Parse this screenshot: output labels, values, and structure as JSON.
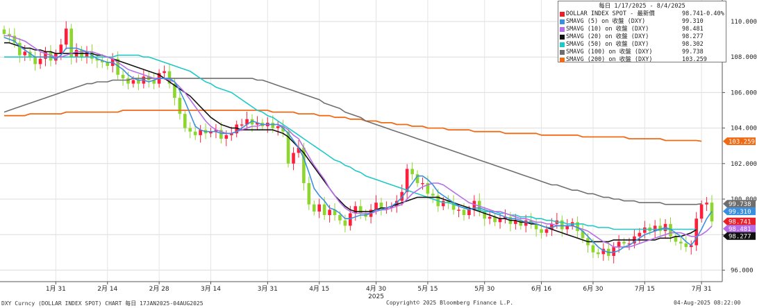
{
  "legend": {
    "header": "每日 1/17/2025 - 8/4/2025",
    "rows": [
      {
        "name": "DOLLAR INDEX SPOT - 最新價",
        "value": "98.741",
        "change": "-0.40%",
        "color": "#e8202a"
      },
      {
        "name": "SMAVG (5)  on 收盤 (DXY)",
        "value": "99.310",
        "change": "",
        "color": "#3b8fe0"
      },
      {
        "name": "SMAVG (10)  on 收盤 (DXY)",
        "value": "98.481",
        "change": "",
        "color": "#b66de8"
      },
      {
        "name": "SMAVG (20)  on 收盤 (DXY)",
        "value": "98.277",
        "change": "",
        "color": "#111111"
      },
      {
        "name": "SMAVG (50)  on 收盤 (DXY)",
        "value": "98.302",
        "change": "",
        "color": "#1ec8c8"
      },
      {
        "name": "SMAVG (100)  on 收盤 (DXY)",
        "value": "99.738",
        "change": "",
        "color": "#6e6e6e"
      },
      {
        "name": "SMAVG (200)  on 收盤 (DXY)",
        "value": "103.259",
        "change": "",
        "color": "#f06a14"
      }
    ]
  },
  "footer": {
    "left": "DXY Curncy (DOLLAR INDEX SPOT) CHART  每日 17JAN2025-04AUG2025",
    "center": "Copyright© 2025 Bloomberg Finance L.P.",
    "right": "04-Aug-2025 08:22:00"
  },
  "chart_data": {
    "type": "candlestick",
    "y_ticks": [
      "110.000",
      "108.000",
      "106.000",
      "104.000",
      "102.000",
      "100.000",
      "98.000",
      "96.000"
    ],
    "ylim": [
      95.2,
      110.5
    ],
    "x_tick_labels": [
      "1月 31",
      "2月 14",
      "2月 28",
      "3月 14",
      "3月 31",
      "4月 15",
      "4月 30",
      "5月 15",
      "5月 30",
      "6月 16",
      "6月 30",
      "7月 15",
      "7月 31"
    ],
    "x_tick_index": [
      10,
      20,
      30,
      40,
      51,
      61,
      72,
      82,
      93,
      104,
      114,
      124,
      135
    ],
    "year_label": "2025",
    "year_index": 72,
    "up_color": "#ff1f3c",
    "down_color": "#8ed62e",
    "close": [
      109.3,
      109.2,
      108.8,
      108.1,
      108.3,
      108.0,
      107.6,
      107.9,
      108.3,
      107.8,
      108.2,
      108.7,
      109.6,
      108.0,
      108.4,
      108.0,
      108.3,
      107.9,
      107.8,
      107.7,
      107.5,
      107.9,
      107.0,
      106.8,
      106.5,
      106.7,
      106.5,
      106.9,
      106.7,
      106.5,
      107.1,
      107.2,
      106.5,
      105.7,
      104.8,
      104.0,
      103.8,
      103.6,
      103.9,
      103.7,
      103.8,
      103.9,
      103.4,
      103.6,
      103.7,
      104.2,
      104.2,
      104.5,
      104.2,
      104.3,
      104.1,
      104.3,
      104.0,
      104.1,
      103.8,
      102.0,
      102.6,
      102.9,
      100.9,
      99.7,
      99.3,
      99.7,
      99.1,
      99.4,
      99.1,
      98.8,
      98.5,
      99.2,
      99.6,
      99.2,
      99.0,
      99.4,
      99.8,
      99.5,
      99.5,
      99.6,
      99.9,
      100.4,
      101.7,
      101.4,
      100.9,
      100.9,
      100.3,
      100.2,
      99.6,
      99.9,
      99.8,
      99.4,
      99.4,
      99.1,
      99.4,
      99.9,
      99.3,
      98.9,
      99.0,
      98.7,
      98.9,
      99.0,
      98.6,
      98.8,
      98.5,
      98.8,
      98.6,
      98.3,
      98.1,
      98.3,
      98.6,
      98.8,
      98.3,
      98.5,
      98.7,
      98.2,
      97.8,
      97.4,
      97.0,
      96.9,
      97.2,
      96.8,
      97.3,
      97.6,
      97.5,
      97.5,
      97.9,
      98.1,
      98.4,
      98.2,
      98.5,
      98.2,
      98.6,
      97.9,
      97.6,
      97.5,
      97.3,
      97.4,
      98.9,
      99.7,
      99.8,
      98.741
    ],
    "sma_5": [
      109.1,
      109.0,
      108.9,
      108.6,
      108.4,
      108.2,
      108.0,
      108.0,
      108.0,
      108.0,
      107.9,
      108.1,
      108.5,
      108.5,
      108.5,
      108.4,
      108.3,
      108.1,
      107.9,
      107.8,
      107.7,
      107.7,
      107.5,
      107.3,
      107.0,
      106.8,
      106.7,
      106.7,
      106.6,
      106.7,
      106.8,
      106.8,
      106.8,
      106.6,
      106.1,
      105.5,
      104.8,
      104.1,
      103.9,
      103.8,
      103.8,
      103.8,
      103.7,
      103.7,
      103.7,
      103.8,
      104.0,
      104.2,
      104.4,
      104.3,
      104.2,
      104.2,
      104.2,
      104.2,
      104.0,
      103.7,
      103.3,
      102.9,
      102.3,
      101.5,
      100.6,
      100.2,
      99.9,
      99.5,
      99.4,
      99.2,
      98.9,
      98.9,
      99.0,
      99.1,
      99.1,
      99.2,
      99.4,
      99.4,
      99.5,
      99.6,
      99.8,
      100.1,
      100.5,
      100.9,
      101.3,
      101.3,
      101.1,
      100.8,
      100.4,
      100.2,
      100.0,
      99.8,
      99.6,
      99.5,
      99.4,
      99.5,
      99.5,
      99.4,
      99.3,
      99.2,
      99.1,
      99.0,
      98.9,
      98.9,
      98.8,
      98.7,
      98.7,
      98.6,
      98.5,
      98.4,
      98.4,
      98.5,
      98.5,
      98.5,
      98.5,
      98.4,
      98.2,
      97.9,
      97.6,
      97.3,
      97.1,
      97.0,
      97.0,
      97.1,
      97.3,
      97.4,
      97.6,
      97.8,
      98.0,
      98.1,
      98.2,
      98.3,
      98.4,
      98.3,
      98.1,
      97.9,
      97.6,
      97.4,
      97.8,
      98.3,
      98.9,
      99.31
    ],
    "sma_10": [
      109.2,
      109.2,
      109.1,
      109.0,
      108.9,
      108.7,
      108.5,
      108.3,
      108.2,
      108.1,
      108.0,
      108.0,
      108.1,
      108.2,
      108.3,
      108.3,
      108.3,
      108.3,
      108.2,
      108.1,
      108.0,
      107.9,
      107.7,
      107.5,
      107.3,
      107.2,
      107.1,
      107.0,
      106.9,
      106.8,
      106.8,
      106.8,
      106.7,
      106.6,
      106.3,
      106.0,
      105.6,
      105.2,
      104.8,
      104.4,
      104.1,
      103.9,
      103.8,
      103.7,
      103.7,
      103.8,
      103.9,
      104.0,
      104.1,
      104.1,
      104.2,
      104.2,
      104.2,
      104.2,
      104.1,
      103.9,
      103.6,
      103.4,
      102.9,
      102.4,
      101.9,
      101.5,
      101.1,
      100.6,
      100.2,
      99.8,
      99.5,
      99.3,
      99.2,
      99.2,
      99.2,
      99.2,
      99.3,
      99.4,
      99.4,
      99.5,
      99.6,
      99.7,
      100.0,
      100.3,
      100.5,
      100.7,
      100.8,
      100.9,
      100.9,
      100.8,
      100.6,
      100.4,
      100.2,
      100.0,
      99.8,
      99.7,
      99.6,
      99.5,
      99.4,
      99.3,
      99.3,
      99.2,
      99.1,
      99.0,
      98.9,
      98.9,
      98.8,
      98.7,
      98.7,
      98.6,
      98.6,
      98.5,
      98.5,
      98.5,
      98.5,
      98.4,
      98.3,
      98.2,
      98.0,
      97.8,
      97.6,
      97.5,
      97.3,
      97.3,
      97.3,
      97.3,
      97.4,
      97.5,
      97.6,
      97.7,
      97.8,
      97.9,
      98.0,
      98.1,
      98.1,
      98.1,
      98.0,
      97.9,
      97.9,
      98.0,
      98.2,
      98.481
    ],
    "sma_20": [
      108.8,
      108.8,
      108.7,
      108.6,
      108.5,
      108.5,
      108.4,
      108.4,
      108.3,
      108.3,
      108.2,
      108.2,
      108.2,
      108.2,
      108.2,
      108.2,
      108.2,
      108.2,
      108.1,
      108.1,
      108.0,
      107.9,
      107.8,
      107.7,
      107.6,
      107.5,
      107.4,
      107.3,
      107.2,
      107.1,
      107.0,
      106.8,
      106.6,
      106.4,
      106.2,
      106.0,
      105.8,
      105.5,
      105.2,
      104.9,
      104.6,
      104.4,
      104.2,
      104.1,
      104.0,
      104.0,
      103.9,
      103.9,
      103.9,
      103.9,
      103.9,
      103.9,
      103.9,
      103.8,
      103.7,
      103.5,
      103.2,
      102.9,
      102.6,
      102.2,
      101.8,
      101.4,
      101.0,
      100.6,
      100.2,
      99.9,
      99.6,
      99.4,
      99.3,
      99.3,
      99.3,
      99.3,
      99.4,
      99.5,
      99.5,
      99.6,
      99.7,
      99.8,
      99.9,
      100.0,
      100.1,
      100.1,
      100.1,
      100.1,
      100.1,
      100.0,
      99.9,
      99.8,
      99.7,
      99.6,
      99.5,
      99.4,
      99.3,
      99.2,
      99.1,
      99.0,
      98.9,
      98.9,
      98.8,
      98.8,
      98.7,
      98.7,
      98.6,
      98.6,
      98.5,
      98.4,
      98.3,
      98.2,
      98.1,
      98.0,
      97.9,
      97.8,
      97.7,
      97.6,
      97.6,
      97.6,
      97.6,
      97.6,
      97.7,
      97.7,
      97.7,
      97.7,
      97.7,
      97.7,
      97.7,
      97.7,
      97.7,
      97.8,
      97.8,
      97.8,
      97.9,
      97.9,
      98.0,
      98.1,
      98.277
    ],
    "sma_50": [
      108.0,
      108.0,
      108.0,
      108.0,
      108.0,
      108.0,
      108.0,
      108.0,
      108.0,
      108.0,
      108.0,
      108.0,
      108.0,
      108.0,
      108.0,
      108.0,
      108.0,
      108.0,
      108.0,
      108.0,
      108.0,
      108.0,
      108.1,
      108.1,
      108.1,
      108.1,
      108.1,
      108.0,
      108.0,
      107.9,
      107.8,
      107.7,
      107.6,
      107.5,
      107.4,
      107.3,
      107.2,
      107.0,
      106.8,
      106.6,
      106.5,
      106.3,
      106.2,
      106.1,
      106.0,
      105.8,
      105.6,
      105.4,
      105.2,
      105.0,
      104.9,
      104.7,
      104.6,
      104.4,
      104.2,
      104.0,
      103.8,
      103.6,
      103.4,
      103.2,
      103.0,
      102.8,
      102.6,
      102.4,
      102.2,
      102.1,
      101.9,
      101.8,
      101.6,
      101.5,
      101.3,
      101.2,
      101.1,
      101.0,
      100.9,
      100.8,
      100.7,
      100.6,
      100.5,
      100.4,
      100.3,
      100.2,
      100.1,
      100.0,
      99.9,
      99.8,
      99.8,
      99.7,
      99.6,
      99.5,
      99.5,
      99.4,
      99.4,
      99.3,
      99.3,
      99.3,
      99.2,
      99.2,
      99.1,
      99.1,
      99.0,
      99.0,
      99.0,
      98.9,
      98.9,
      98.8,
      98.8,
      98.7,
      98.7,
      98.6,
      98.6,
      98.6,
      98.6,
      98.5,
      98.5,
      98.4,
      98.4,
      98.4,
      98.3,
      98.3,
      98.3,
      98.3,
      98.3,
      98.3,
      98.3,
      98.3,
      98.3,
      98.3,
      98.3,
      98.3,
      98.3,
      98.3,
      98.3,
      98.3,
      98.302
    ],
    "sma_100": [
      104.9,
      105.0,
      105.1,
      105.2,
      105.3,
      105.4,
      105.5,
      105.6,
      105.7,
      105.8,
      105.9,
      106.0,
      106.1,
      106.2,
      106.3,
      106.4,
      106.5,
      106.5,
      106.6,
      106.6,
      106.6,
      106.7,
      106.7,
      106.7,
      106.7,
      106.8,
      106.8,
      106.8,
      106.8,
      106.8,
      106.8,
      106.8,
      106.8,
      106.8,
      106.8,
      106.8,
      106.8,
      106.8,
      106.8,
      106.8,
      106.8,
      106.8,
      106.8,
      106.8,
      106.8,
      106.8,
      106.8,
      106.8,
      106.8,
      106.7,
      106.7,
      106.6,
      106.5,
      106.4,
      106.3,
      106.2,
      106.1,
      106.0,
      105.9,
      105.8,
      105.7,
      105.6,
      105.4,
      105.3,
      105.2,
      105.1,
      104.9,
      104.8,
      104.7,
      104.6,
      104.4,
      104.3,
      104.2,
      104.1,
      104.0,
      103.9,
      103.8,
      103.7,
      103.6,
      103.5,
      103.4,
      103.3,
      103.2,
      103.1,
      103.0,
      102.9,
      102.8,
      102.7,
      102.6,
      102.5,
      102.4,
      102.3,
      102.2,
      102.1,
      102.0,
      101.9,
      101.8,
      101.7,
      101.6,
      101.5,
      101.4,
      101.3,
      101.2,
      101.1,
      101.0,
      100.9,
      100.8,
      100.8,
      100.7,
      100.6,
      100.5,
      100.5,
      100.4,
      100.3,
      100.3,
      100.2,
      100.1,
      100.1,
      100.0,
      100.0,
      99.9,
      99.9,
      99.9,
      99.8,
      99.8,
      99.8,
      99.8,
      99.8,
      99.7,
      99.7,
      99.7,
      99.7,
      99.7,
      99.7,
      99.7,
      99.738
    ],
    "sma_200": [
      104.7,
      104.7,
      104.7,
      104.7,
      104.7,
      104.8,
      104.8,
      104.8,
      104.8,
      104.8,
      104.8,
      104.8,
      104.9,
      104.9,
      104.9,
      104.9,
      104.9,
      104.9,
      104.9,
      104.9,
      104.9,
      104.9,
      104.9,
      105.0,
      105.0,
      105.0,
      105.0,
      105.0,
      105.0,
      105.0,
      105.0,
      105.0,
      105.0,
      105.0,
      105.0,
      105.0,
      105.0,
      105.0,
      105.0,
      105.0,
      105.0,
      105.0,
      105.0,
      105.0,
      105.0,
      105.0,
      105.0,
      105.0,
      105.0,
      105.0,
      105.0,
      105.0,
      104.9,
      104.9,
      104.9,
      104.9,
      104.9,
      104.8,
      104.8,
      104.8,
      104.8,
      104.7,
      104.7,
      104.7,
      104.6,
      104.6,
      104.6,
      104.5,
      104.5,
      104.5,
      104.4,
      104.4,
      104.4,
      104.3,
      104.3,
      104.3,
      104.2,
      104.2,
      104.2,
      104.1,
      104.1,
      104.1,
      104.0,
      104.0,
      104.0,
      104.0,
      103.9,
      103.9,
      103.9,
      103.9,
      103.9,
      103.8,
      103.8,
      103.8,
      103.8,
      103.8,
      103.8,
      103.7,
      103.7,
      103.7,
      103.7,
      103.7,
      103.7,
      103.7,
      103.6,
      103.6,
      103.6,
      103.6,
      103.6,
      103.6,
      103.6,
      103.6,
      103.5,
      103.5,
      103.5,
      103.5,
      103.5,
      103.5,
      103.5,
      103.5,
      103.5,
      103.4,
      103.4,
      103.4,
      103.4,
      103.4,
      103.4,
      103.4,
      103.3,
      103.3,
      103.3,
      103.3,
      103.3,
      103.3,
      103.3,
      103.259
    ],
    "right_axis_labels": [
      {
        "text": "103.259",
        "value": 103.259,
        "color": "#f06a14"
      },
      {
        "text": "99.738",
        "value": 99.738,
        "color": "#6e6e6e"
      },
      {
        "text": "99.310",
        "value": 99.31,
        "color": "#3b8fe0"
      },
      {
        "text": "98.741",
        "value": 98.741,
        "color": "#e8202a"
      },
      {
        "text": "98.481",
        "value": 98.481,
        "color": "#b66de8"
      },
      {
        "text": "98.277",
        "value": 98.277,
        "color": "#111111"
      }
    ]
  }
}
